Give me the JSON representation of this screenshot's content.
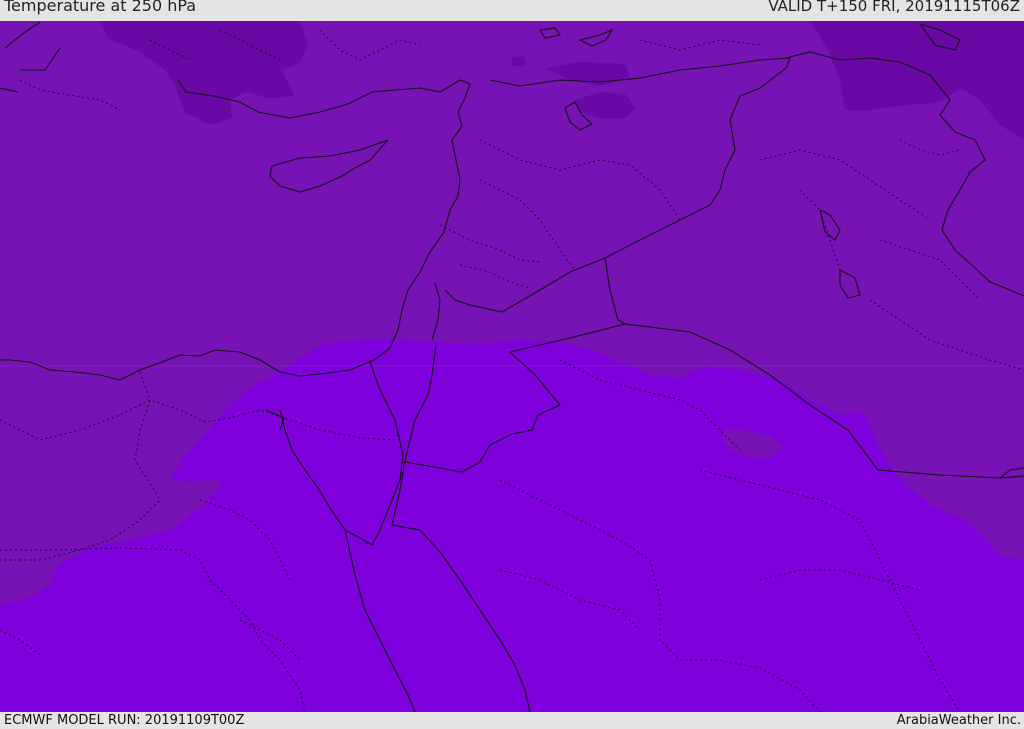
{
  "header": {
    "title": "Temperature at 250 hPa",
    "valid_time": "VALID T+150 FRI, 20191115T06Z"
  },
  "footer": {
    "model_run": "ECMWF MODEL RUN: 20191109T00Z",
    "credit": "ArabiaWeather Inc."
  },
  "colors": {
    "bands": {
      "coldest": "#6a08a6",
      "cold": "#7712b5",
      "warm": "#7e00dc"
    },
    "border_line": "#111111",
    "background": "#e4e4e4"
  }
}
